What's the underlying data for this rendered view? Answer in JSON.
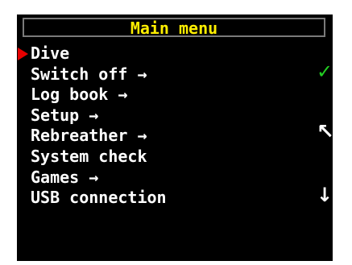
{
  "colors": {
    "background": "#000000",
    "title_text": "#ffee00",
    "menu_text": "#ffffff",
    "cursor": "#e60000",
    "confirm_icon": "#22cc22",
    "nav_icons": "#ffffff",
    "title_border": "#7a7a7a"
  },
  "header": {
    "title": "Main menu"
  },
  "menu": {
    "selected_index": 0,
    "items": [
      {
        "label": "Dive"
      },
      {
        "label": "Switch off →"
      },
      {
        "label": "Log book →"
      },
      {
        "label": "Setup →"
      },
      {
        "label": "Rebreather →"
      },
      {
        "label": "System check"
      },
      {
        "label": "Games →"
      },
      {
        "label": "USB connection"
      }
    ]
  },
  "side_buttons": {
    "confirm": {
      "icon": "checkmark-icon",
      "glyph": "✓"
    },
    "back": {
      "icon": "arrow-up-left-icon",
      "glyph": "↖"
    },
    "next": {
      "icon": "arrow-down-icon",
      "glyph": "↓"
    }
  }
}
